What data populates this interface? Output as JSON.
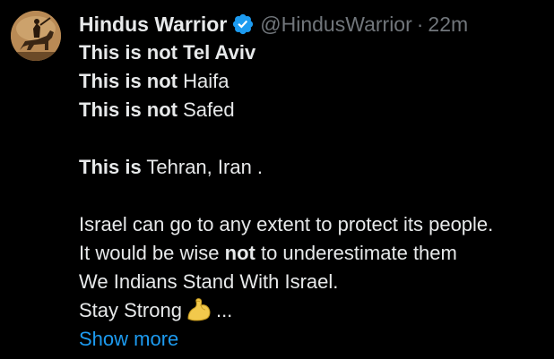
{
  "author": {
    "display_name": "Hindus Warrior",
    "handle": "@HindusWarrior",
    "separator": "·",
    "timestamp": "22m",
    "verified_color": "#1d9bf0"
  },
  "tweet": {
    "line1": {
      "bold": "This is not Tel Aviv",
      "rest": ""
    },
    "line2": {
      "bold": "This is not",
      "rest": " Haifa"
    },
    "line3": {
      "bold": "This is not",
      "rest": " Safed"
    },
    "line4": {
      "bold": "This is",
      "rest": " Tehran, Iran ."
    },
    "line5": "Israel can go to any extent to protect its people.",
    "line6": {
      "before": "It would be wise ",
      "bold": "not",
      "after": " to underestimate them"
    },
    "line7": "We Indians Stand With Israel.",
    "line8": {
      "text": "Stay Strong",
      "emoji": "flexed-biceps",
      "ellipsis": "..."
    },
    "show_more": "Show more"
  }
}
